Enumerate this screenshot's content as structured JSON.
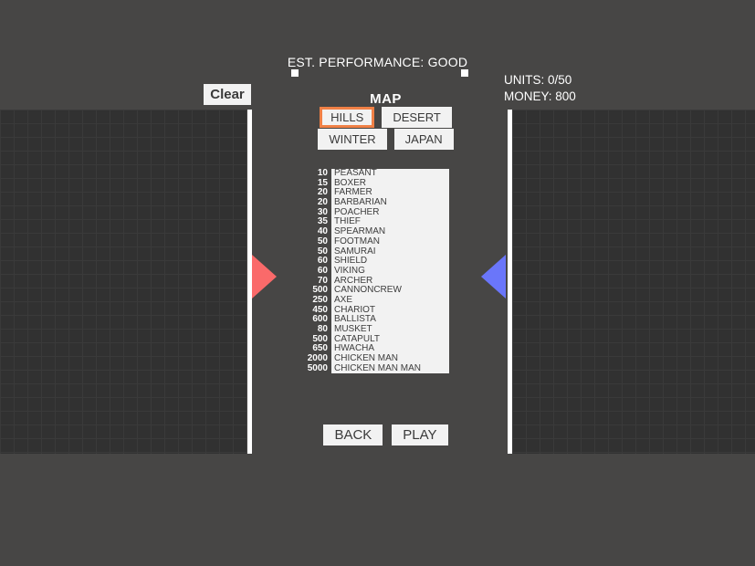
{
  "header": {
    "performance_label": "EST. PERFORMANCE: GOOD",
    "units_stat": "UNITS: 0/50",
    "money_stat": "MONEY: 800",
    "clear_label": "Clear"
  },
  "map": {
    "title": "MAP",
    "selected": "HILLS",
    "options": [
      {
        "label": "HILLS",
        "selected": true
      },
      {
        "label": "DESERT",
        "selected": false
      },
      {
        "label": "WINTER",
        "selected": false
      },
      {
        "label": "JAPAN",
        "selected": false
      }
    ]
  },
  "units": [
    {
      "cost": "10",
      "name": "PEASANT"
    },
    {
      "cost": "15",
      "name": "BOXER"
    },
    {
      "cost": "20",
      "name": "FARMER"
    },
    {
      "cost": "20",
      "name": "BARBARIAN"
    },
    {
      "cost": "30",
      "name": "POACHER"
    },
    {
      "cost": "35",
      "name": "THIEF"
    },
    {
      "cost": "40",
      "name": "SPEARMAN"
    },
    {
      "cost": "50",
      "name": "FOOTMAN"
    },
    {
      "cost": "50",
      "name": "SAMURAI"
    },
    {
      "cost": "60",
      "name": "SHIELD"
    },
    {
      "cost": "60",
      "name": "VIKING"
    },
    {
      "cost": "70",
      "name": "ARCHER"
    },
    {
      "cost": "500",
      "name": "CANNONCREW"
    },
    {
      "cost": "250",
      "name": "AXE"
    },
    {
      "cost": "450",
      "name": "CHARIOT"
    },
    {
      "cost": "600",
      "name": "BALLISTA"
    },
    {
      "cost": "80",
      "name": "MUSKET"
    },
    {
      "cost": "500",
      "name": "CATAPULT"
    },
    {
      "cost": "650",
      "name": "HWACHA"
    },
    {
      "cost": "2000",
      "name": "CHICKEN MAN"
    },
    {
      "cost": "5000",
      "name": "CHICKEN MAN MAN"
    }
  ],
  "footer": {
    "back_label": "BACK",
    "play_label": "PLAY"
  },
  "colors": {
    "background": "#474645",
    "field": "#313131",
    "grid_line": "#3a3a3a",
    "deploy_bar": "#ffffff",
    "arrow_left": "#fa6a6a",
    "arrow_right": "#6a76fa",
    "button_face": "#f2f2f2",
    "selection": "#f08046"
  }
}
